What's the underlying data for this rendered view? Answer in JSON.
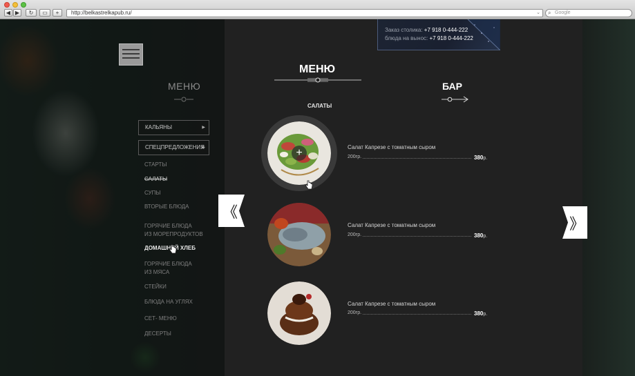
{
  "browser": {
    "url": "http://belkastrelkapub.ru/",
    "search_placeholder": "Google",
    "back_icon": "◀",
    "forward_icon": "▶",
    "reload_icon": "↻",
    "reader_icon": "▭",
    "new_tab_icon": "+"
  },
  "sidebar": {
    "title": "МЕНЮ",
    "buttons": [
      {
        "label": "КАЛЬЯНЫ"
      },
      {
        "label": "СПЕЦПРЕДЛОЖЕНИЯ"
      }
    ],
    "items": [
      {
        "label": "СТАРТЫ"
      },
      {
        "label": "САЛАТЫ"
      },
      {
        "label": "СУПЫ"
      },
      {
        "label": "ВТОРЫЕ БЛЮДА"
      },
      {
        "label": "ГОРЯЧИЕ БЛЮДА"
      },
      {
        "label": "ИЗ МОРЕПРОДУКТОВ"
      },
      {
        "label": "ДОМАШНИЙ ХЛЕБ"
      },
      {
        "label": "ГОРЯЧИЕ БЛЮДА"
      },
      {
        "label": "ИЗ МЯСА"
      },
      {
        "label": "СТЕЙКИ"
      },
      {
        "label": "БЛЮДА НА УГЛЯХ"
      },
      {
        "label": "СЕТ- МЕНЮ"
      },
      {
        "label": "ДЕСЕРТЫ"
      }
    ]
  },
  "contact": {
    "line1_label": "Заказ столика:",
    "line1_phone": "+7 918 0-444-222",
    "line2_label": "блюда на вынос:",
    "line2_phone": "+7 918 0-444-222"
  },
  "tabs": {
    "menu": "МЕНЮ",
    "bar": "БАР"
  },
  "section_title": "САЛАТЫ",
  "dishes": [
    {
      "name": "Салат Капрезе с томатным сыром",
      "weight": "200гр.",
      "price": "380",
      "currency": "р."
    },
    {
      "name": "Салат Капрезе с томатным сыром",
      "weight": "200гр.",
      "price": "380",
      "currency": "р."
    },
    {
      "name": "Салат Капрезе с томатным сыром",
      "weight": "200гр.",
      "price": "380",
      "currency": "р."
    }
  ],
  "nav": {
    "prev_glyph": "《",
    "next_glyph": "》"
  },
  "dish_add_glyph": "+"
}
